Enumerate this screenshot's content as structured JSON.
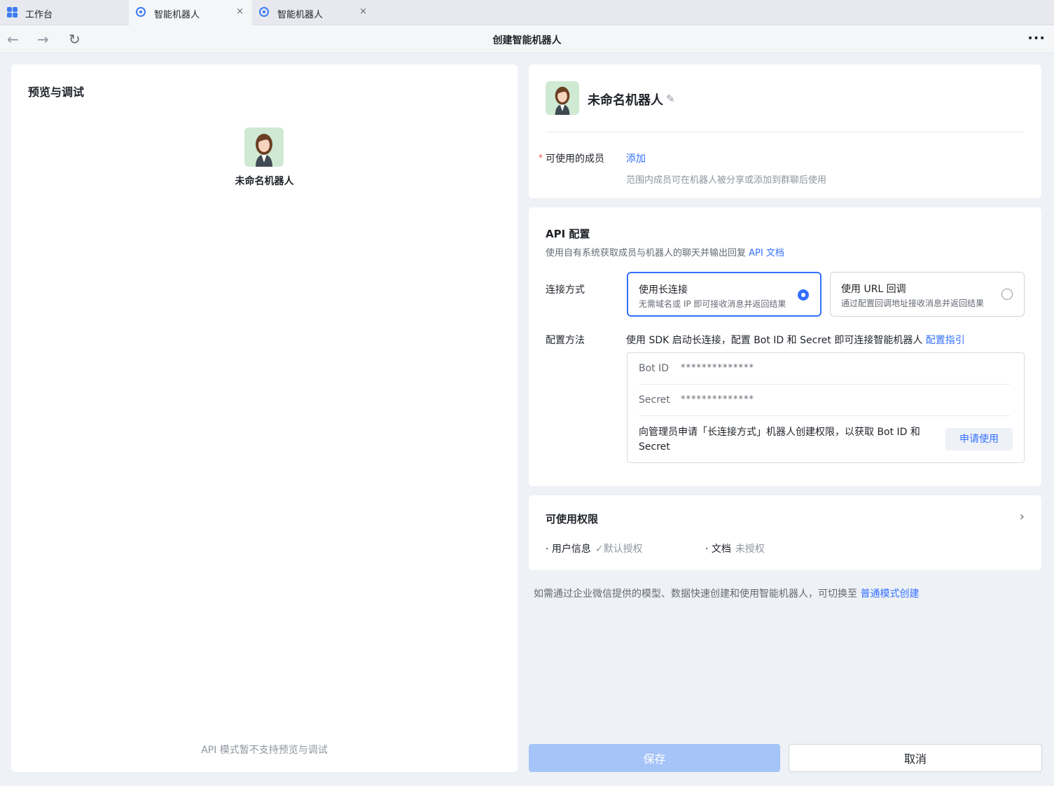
{
  "tabs": [
    {
      "label": "工作台",
      "icon": "workbench-grid-icon"
    },
    {
      "label": "智能机器人",
      "icon": "bot-icon",
      "close": "×"
    },
    {
      "label": "智能机器人",
      "icon": "bot-icon",
      "close": "×"
    }
  ],
  "nav": {
    "back": "←",
    "forward": "→",
    "refresh": "↻",
    "title": "创建智能机器人",
    "more": "···"
  },
  "preview": {
    "title": "预览与调试",
    "bot_name": "未命名机器人",
    "footer": "API 模式暂不支持预览与调试"
  },
  "bot": {
    "name": "未命名机器人",
    "edit_icon": "✎",
    "required_mark": "*",
    "members_label": "可使用的成员",
    "add_link": "添加",
    "members_hint": "范围内成员可在机器人被分享或添加到群聊后使用"
  },
  "api": {
    "title": "API 配置",
    "desc": "使用自有系统获取成员与机器人的聊天并输出回复",
    "doc_link": "API 文档",
    "connection_label": "连接方式",
    "options": [
      {
        "title": "使用长连接",
        "desc": "无需域名或 IP 即可接收消息并返回结果",
        "selected": true
      },
      {
        "title": "使用 URL 回调",
        "desc": "通过配置回调地址接收消息并返回结果",
        "selected": false
      }
    ],
    "config_label": "配置方法",
    "config_desc": "使用 SDK 启动长连接，配置 Bot ID 和 Secret 即可连接智能机器人",
    "config_link": "配置指引",
    "bot_id_label": "Bot ID",
    "bot_id_value": "**************",
    "secret_label": "Secret",
    "secret_value": "**************",
    "apply_text": "向管理员申请「长连接方式」机器人创建权限，以获取 Bot ID 和 Secret",
    "apply_button": "申请使用"
  },
  "permissions": {
    "title": "可使用权限",
    "chevron": "›",
    "items": [
      {
        "bullet": "·",
        "name": "用户信息",
        "status": "✓默认授权"
      },
      {
        "bullet": "·",
        "name": "文档",
        "status": "未授权"
      }
    ]
  },
  "switch_hint": {
    "text": "如需通过企业微信提供的模型、数据快速创建和使用智能机器人，可切换至",
    "link": "普通模式创建"
  },
  "actions": {
    "save": "保存",
    "cancel": "取消"
  },
  "colors": {
    "accent": "#3370ff",
    "save_disabled": "#a5c4f7",
    "required": "#f54a45"
  }
}
